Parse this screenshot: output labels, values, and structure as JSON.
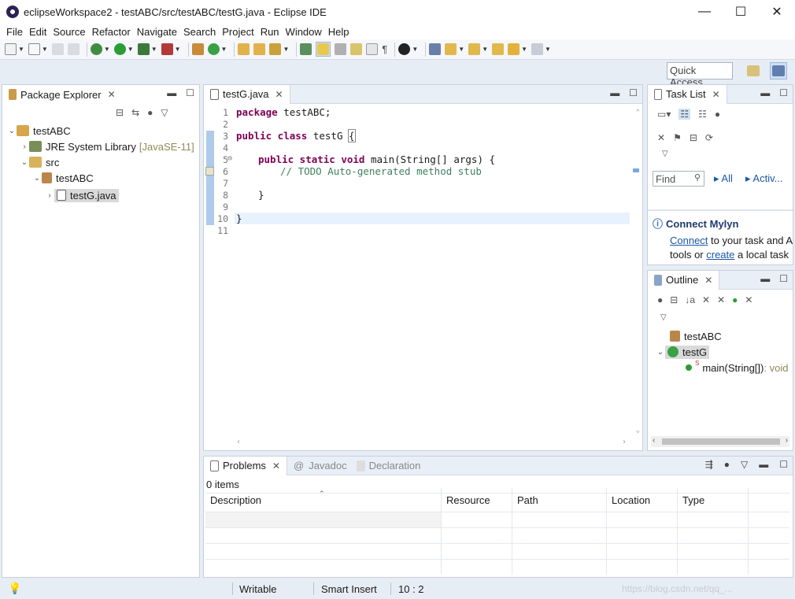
{
  "window": {
    "title": "eclipseWorkspace2 - testABC/src/testABC/testG.java - Eclipse IDE",
    "minimize": "—",
    "maximize": "☐",
    "close": "✕"
  },
  "menu": [
    "File",
    "Edit",
    "Source",
    "Refactor",
    "Navigate",
    "Search",
    "Project",
    "Run",
    "Window",
    "Help"
  ],
  "quick_access": "Quick Access",
  "package_explorer": {
    "tab": "Package Explorer",
    "tree": [
      {
        "label": "testABC",
        "extra": ""
      },
      {
        "label": "JRE System Library",
        "extra": "[JavaSE-11]"
      },
      {
        "label": "src",
        "extra": ""
      },
      {
        "label": "testABC",
        "extra": ""
      },
      {
        "label": "testG.java",
        "extra": ""
      }
    ]
  },
  "editor": {
    "tab": "testG.java",
    "line_numbers": [
      "1",
      "2",
      "3",
      "4",
      "5",
      "6",
      "7",
      "8",
      "9",
      "10",
      "11"
    ],
    "fold_marker": "⊖",
    "lines": {
      "l1_kw": "package",
      "l1_rest": " testABC;",
      "l3_kw": "public class",
      "l3_rest": " testG ",
      "l3_brace": "{",
      "l5_kw": "public static void",
      "l5_rest": " main(String[] args) {",
      "l6_comment": "// TODO Auto-generated method stub",
      "l8": "}",
      "l10": "}"
    }
  },
  "task_list": {
    "tab": "Task List",
    "find_placeholder": "Find",
    "all": "All",
    "activate": "Activ..."
  },
  "mylyn": {
    "title": "Connect Mylyn",
    "connect": "Connect",
    "text1": " to your task and A",
    "text2": "tools or ",
    "create": "create",
    "text3": " a local task"
  },
  "outline": {
    "tab": "Outline",
    "items": [
      {
        "label": "testABC"
      },
      {
        "label": "testG"
      },
      {
        "label": "main(String[])",
        "type": " : void"
      }
    ]
  },
  "bottom": {
    "tabs": [
      "Problems",
      "Javadoc",
      "Declaration"
    ],
    "count": "0 items",
    "columns": [
      "Description",
      "Resource",
      "Path",
      "Location",
      "Type"
    ]
  },
  "status": {
    "writable": "Writable",
    "insert": "Smart Insert",
    "position": "10 : 2",
    "watermark": "https://blog.csdn.net/qq_..."
  },
  "colors": {
    "keyword": "#7f0055",
    "comment": "#3f7f5f",
    "link": "#1a56a6",
    "panel_header": "#e9eff7"
  }
}
